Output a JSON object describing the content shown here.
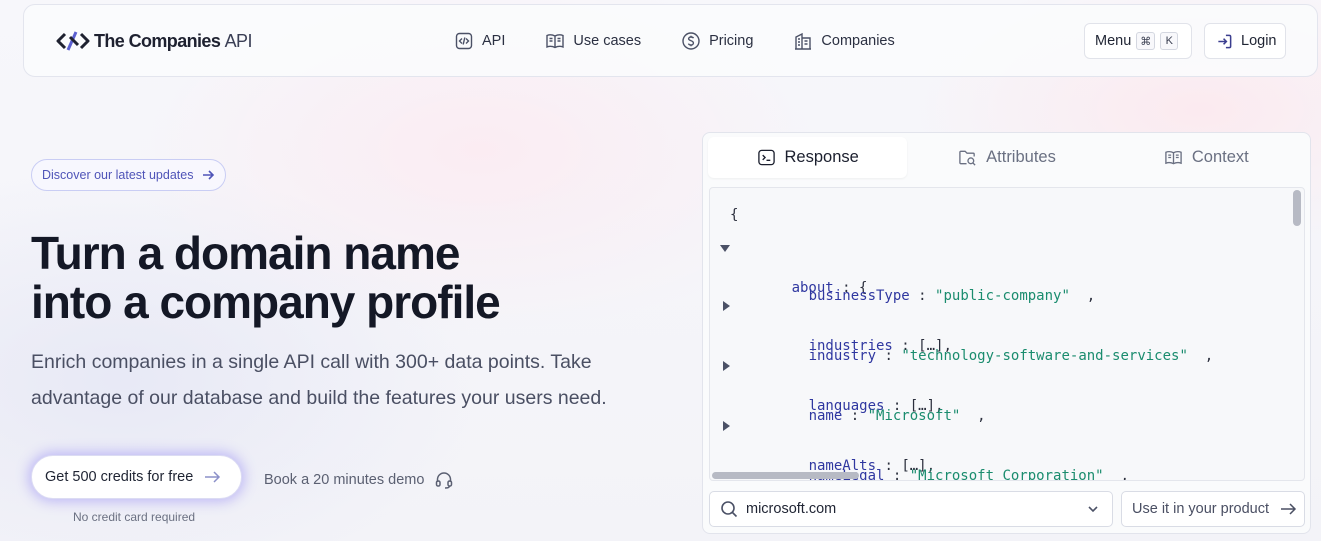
{
  "header": {
    "brand": {
      "name": "The Companies",
      "suffix": "API"
    },
    "nav": [
      {
        "label": "API",
        "icon": "code-icon"
      },
      {
        "label": "Use cases",
        "icon": "book-icon"
      },
      {
        "label": "Pricing",
        "icon": "dollar-icon"
      },
      {
        "label": "Companies",
        "icon": "building-icon"
      }
    ],
    "menu": {
      "label": "Menu",
      "shortcut_cmd": "⌘",
      "shortcut_key": "K"
    },
    "login": {
      "label": "Login"
    }
  },
  "hero": {
    "badge": "Discover our latest updates",
    "headline_line1": "Turn a domain name",
    "headline_line2": "into a company profile",
    "subtext": "Enrich companies in a single API call with 300+ data points. Take advantage of our database and build the features your users need.",
    "cta_label": "Get 500 credits for free",
    "cta_note": "No credit card required",
    "demo_label": "Book a 20 minutes demo"
  },
  "panel": {
    "tabs": [
      {
        "label": "Response",
        "active": true
      },
      {
        "label": "Attributes",
        "active": false
      },
      {
        "label": "Context",
        "active": false
      }
    ],
    "code": {
      "open_brace": "{",
      "root_key": "about",
      "entries": [
        {
          "key": "businessType",
          "value": "\"public-company\"",
          "expandable": false
        },
        {
          "key": "industries",
          "value": "[…]",
          "expandable": true
        },
        {
          "key": "industry",
          "value": "\"technology-software-and-services\"",
          "expandable": false
        },
        {
          "key": "languages",
          "value": "[…]",
          "expandable": true
        },
        {
          "key": "name",
          "value": "\"Microsoft\"",
          "expandable": false
        },
        {
          "key": "nameAlts",
          "value": "[…]",
          "expandable": true
        },
        {
          "key": "nameLegal",
          "value": "\"Microsoft Corporation\"",
          "expandable": false
        }
      ]
    },
    "domain_input": "microsoft.com",
    "use_button": "Use it in your product"
  },
  "colors": {
    "accent": "#4f54b8",
    "json_key": "#2f37a0",
    "json_string": "#1a8c6e",
    "cta_glow": "#897df4"
  }
}
